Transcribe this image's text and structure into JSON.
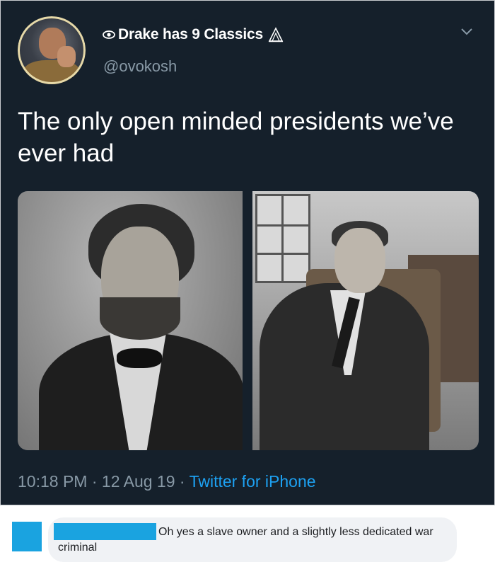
{
  "tweet": {
    "display_name": "Drake has 9 Classics",
    "handle": "@ovokosh",
    "text": "The only open minded presidents we’ve ever had",
    "time": "10:18 PM",
    "date": "12 Aug 19",
    "app": "Twitter for iPhone",
    "separator": "·",
    "colors": {
      "background": "#15202b",
      "secondary_text": "#8899a6",
      "link": "#1da1f2"
    },
    "icons": [
      "eye-icon",
      "owl-icon",
      "chevron-down-icon"
    ]
  },
  "reply": {
    "text": "Oh yes a slave owner and a slightly less dedicated war criminal",
    "redaction_color": "#1aa3e0"
  }
}
